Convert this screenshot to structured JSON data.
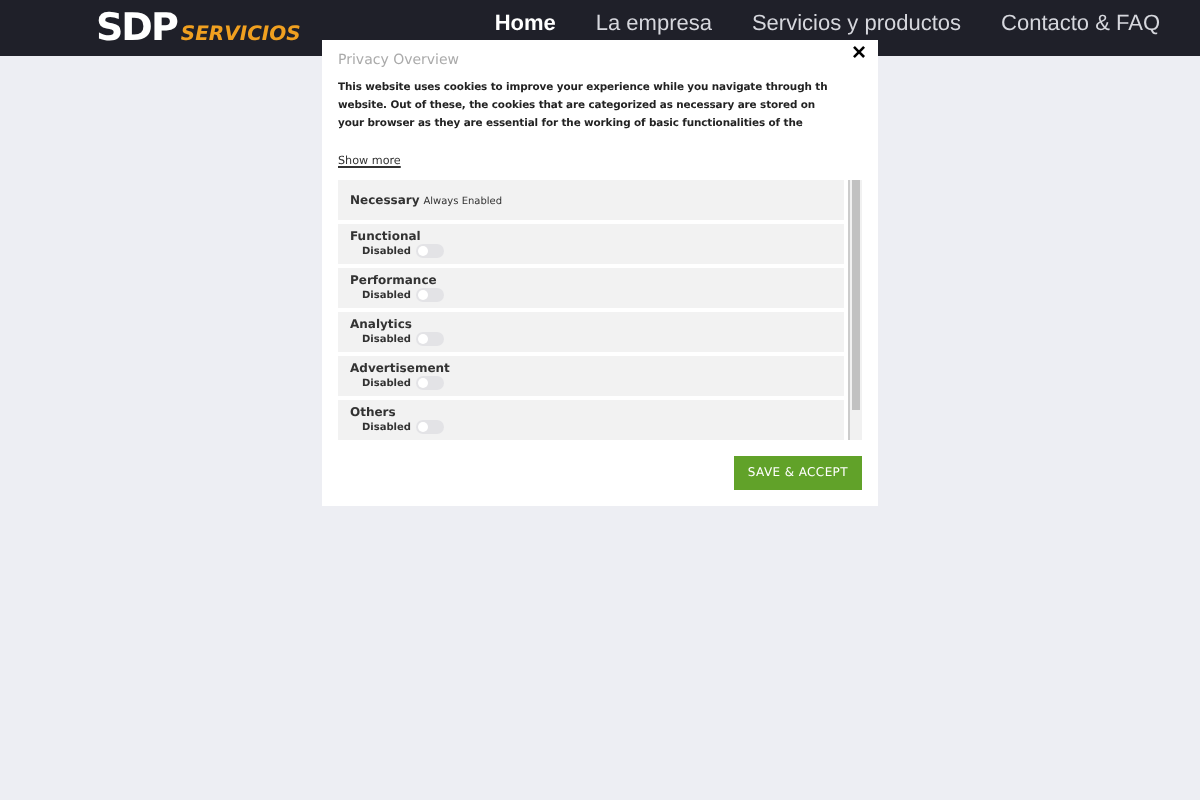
{
  "header": {
    "logo": {
      "main": "SDP",
      "sub": "SERVICIOS"
    },
    "nav": [
      {
        "label": "Home",
        "selected": true
      },
      {
        "label": "La empresa",
        "selected": false
      },
      {
        "label": "Servicios y productos",
        "selected": false
      },
      {
        "label": "Contacto & FAQ",
        "selected": false
      }
    ]
  },
  "modal": {
    "close": "×",
    "title": "Privacy Overview",
    "text_lines": [
      "This website uses cookies to improve your experience while you navigate through th",
      "website. Out of these, the cookies that are categorized as necessary are stored on",
      "your browser as they are essential for the working of basic functionalities of the"
    ],
    "show_more": "Show more",
    "categories": [
      {
        "kind": "fixed",
        "name": "Necessary",
        "status": "Always Enabled"
      },
      {
        "kind": "toggle",
        "name": "Functional",
        "status": "Disabled",
        "on": false
      },
      {
        "kind": "toggle",
        "name": "Performance",
        "status": "Disabled",
        "on": false
      },
      {
        "kind": "toggle",
        "name": "Analytics",
        "status": "Disabled",
        "on": false
      },
      {
        "kind": "toggle",
        "name": "Advertisement",
        "status": "Disabled",
        "on": false
      },
      {
        "kind": "toggle",
        "name": "Others",
        "status": "Disabled",
        "on": false
      }
    ],
    "button": "SAVE & ACCEPT"
  }
}
